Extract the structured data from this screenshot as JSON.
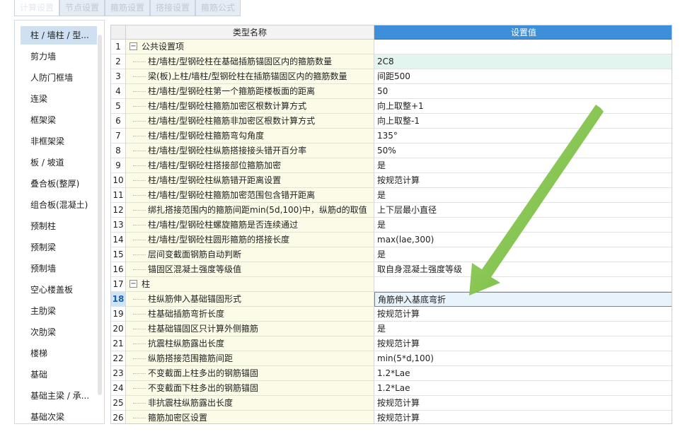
{
  "tabs": [
    "计算设置",
    "节点设置",
    "箍筋设置",
    "搭接设置",
    "箍筋公式"
  ],
  "sidebar": {
    "items": [
      "柱 / 墙柱 / 型...",
      "剪力墙",
      "人防门框墙",
      "连梁",
      "框架梁",
      "非框架梁",
      "板 / 坡道",
      "叠合板(整厚)",
      "组合板(混凝土)",
      "预制柱",
      "预制梁",
      "预制墙",
      "空心楼盖板",
      "主肋梁",
      "次肋梁",
      "楼梯",
      "基础",
      "基础主梁 / 承...",
      "基础次梁"
    ],
    "selected_index": 0
  },
  "grid": {
    "header_name": "类型名称",
    "header_value": "设置值",
    "rows": [
      {
        "num": "1",
        "name": "公共设置项",
        "value": "",
        "type": "group"
      },
      {
        "num": "2",
        "name": "柱/墙柱/型钢砼柱在基础插筋锚固区内的箍筋数量",
        "value": "2C8",
        "type": "item",
        "hl": true
      },
      {
        "num": "3",
        "name": "梁(板)上柱/墙柱/型钢砼柱在插筋锚固区内的箍筋数量",
        "value": "间距500",
        "type": "item"
      },
      {
        "num": "4",
        "name": "柱/墙柱/型钢砼柱第一个箍筋距楼板面的距离",
        "value": "50",
        "type": "item"
      },
      {
        "num": "5",
        "name": "柱/墙柱/型钢砼柱箍筋加密区根数计算方式",
        "value": "向上取整+1",
        "type": "item"
      },
      {
        "num": "6",
        "name": "柱/墙柱/型钢砼柱箍筋非加密区根数计算方式",
        "value": "向上取整-1",
        "type": "item"
      },
      {
        "num": "7",
        "name": "柱/墙柱/型钢砼柱箍筋弯勾角度",
        "value": "135°",
        "type": "item"
      },
      {
        "num": "8",
        "name": "柱/墙柱/型钢砼柱纵筋搭接接头错开百分率",
        "value": "50%",
        "type": "item"
      },
      {
        "num": "9",
        "name": "柱/墙柱/型钢砼柱搭接部位箍筋加密",
        "value": "是",
        "type": "item"
      },
      {
        "num": "10",
        "name": "柱/墙柱/型钢砼柱纵筋错开距离设置",
        "value": "按规范计算",
        "type": "item"
      },
      {
        "num": "11",
        "name": "柱/墙柱/型钢砼柱箍筋加密范围包含错开距离",
        "value": "是",
        "type": "item"
      },
      {
        "num": "12",
        "name": "绑扎搭接范围内的箍筋间距min(5d,100)中，纵筋d的取值",
        "value": "上下层最小直径",
        "type": "item"
      },
      {
        "num": "13",
        "name": "柱/墙柱/型钢砼柱螺旋箍筋是否连续通过",
        "value": "是",
        "type": "item"
      },
      {
        "num": "14",
        "name": "柱/墙柱/型钢砼柱圆形箍筋的搭接长度",
        "value": "max(lae,300)",
        "type": "item"
      },
      {
        "num": "15",
        "name": "层间变截面钢筋自动判断",
        "value": "是",
        "type": "item"
      },
      {
        "num": "16",
        "name": "锚固区混凝土强度等级值",
        "value": "取自身混凝土强度等级",
        "type": "item"
      },
      {
        "num": "17",
        "name": "柱",
        "value": "",
        "type": "group"
      },
      {
        "num": "18",
        "name": "柱纵筋伸入基础锚固形式",
        "value": "角筋伸入基底弯折",
        "type": "item",
        "selected": true
      },
      {
        "num": "19",
        "name": "柱基础插筋弯折长度",
        "value": "按规范计算",
        "type": "item"
      },
      {
        "num": "20",
        "name": "柱基础锚固区只计算外侧箍筋",
        "value": "是",
        "type": "item"
      },
      {
        "num": "21",
        "name": "抗震柱纵筋露出长度",
        "value": "按规范计算",
        "type": "item"
      },
      {
        "num": "22",
        "name": "纵筋搭接范围箍筋间距",
        "value": "min(5*d,100)",
        "type": "item"
      },
      {
        "num": "23",
        "name": "不变截面上柱多出的钢筋锚固",
        "value": "1.2*Lae",
        "type": "item"
      },
      {
        "num": "24",
        "name": "不变截面下柱多出的钢筋锚固",
        "value": "1.2*Lae",
        "type": "item"
      },
      {
        "num": "25",
        "name": "非抗震柱纵筋露出长度",
        "value": "按规范计算",
        "type": "item"
      },
      {
        "num": "26",
        "name": "箍筋加密区设置",
        "value": "按规范计算",
        "type": "item"
      }
    ]
  },
  "colors": {
    "header_value_bg": "#3d8fd9",
    "name_cell_bg": "#fbfbe8",
    "selected_sidebar_bg": "#cfe0f3",
    "arrow_green": "#7cc242"
  },
  "icons": {
    "collapse": "minus-box-icon",
    "arrow": "green-arrow-annotation"
  }
}
